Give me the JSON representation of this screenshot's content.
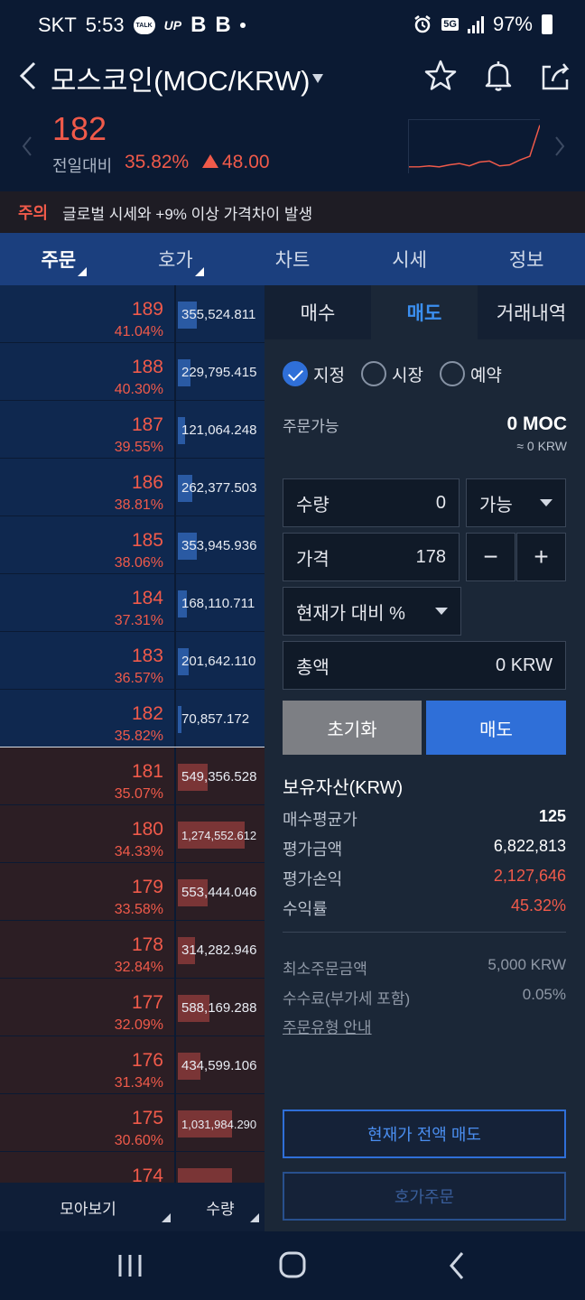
{
  "status_bar": {
    "carrier": "SKT",
    "time": "5:53",
    "talk_badge": "TALK",
    "up_badge": "UP",
    "b1": "B",
    "b2": "B",
    "net": "5G",
    "battery": "97%"
  },
  "header": {
    "title": "모스코인(MOC/KRW)"
  },
  "ticker": {
    "price": "182",
    "change_label": "전일대비",
    "change_pct": "35.82%",
    "change_amt": "48.00",
    "sparkline": [
      0.08,
      0.08,
      0.1,
      0.08,
      0.12,
      0.15,
      0.1,
      0.18,
      0.2,
      0.1,
      0.12,
      0.22,
      0.3,
      0.95
    ]
  },
  "warning": {
    "label": "주의",
    "text": "글로벌 시세와 +9% 이상 가격차이 발생"
  },
  "tabs": [
    "주문",
    "호가",
    "차트",
    "시세",
    "정보"
  ],
  "orderbook": {
    "rows": [
      {
        "side": "ask",
        "price": "189",
        "pct": "41.04%",
        "volume": "355,524.811",
        "level": 0.27
      },
      {
        "side": "ask",
        "price": "188",
        "pct": "40.30%",
        "volume": "229,795.415",
        "level": 0.18
      },
      {
        "side": "ask",
        "price": "187",
        "pct": "39.55%",
        "volume": "121,064.248",
        "level": 0.1
      },
      {
        "side": "ask",
        "price": "186",
        "pct": "38.81%",
        "volume": "262,377.503",
        "level": 0.21
      },
      {
        "side": "ask",
        "price": "185",
        "pct": "38.06%",
        "volume": "353,945.936",
        "level": 0.27
      },
      {
        "side": "ask",
        "price": "184",
        "pct": "37.31%",
        "volume": "168,110.711",
        "level": 0.13
      },
      {
        "side": "ask",
        "price": "183",
        "pct": "36.57%",
        "volume": "201,642.110",
        "level": 0.16
      },
      {
        "side": "ask",
        "price": "182",
        "pct": "35.82%",
        "volume": "70,857.172",
        "level": 0.05,
        "current": true
      },
      {
        "side": "bid",
        "price": "181",
        "pct": "35.07%",
        "volume": "549,356.528",
        "level": 0.43
      },
      {
        "side": "bid",
        "price": "180",
        "pct": "34.33%",
        "volume": "1,274,552.612",
        "level": 0.98
      },
      {
        "side": "bid",
        "price": "179",
        "pct": "33.58%",
        "volume": "553,444.046",
        "level": 0.43
      },
      {
        "side": "bid",
        "price": "178",
        "pct": "32.84%",
        "volume": "314,282.946",
        "level": 0.25
      },
      {
        "side": "bid",
        "price": "177",
        "pct": "32.09%",
        "volume": "588,169.288",
        "level": 0.46
      },
      {
        "side": "bid",
        "price": "176",
        "pct": "31.34%",
        "volume": "434,599.106",
        "level": 0.33
      },
      {
        "side": "bid",
        "price": "175",
        "pct": "30.60%",
        "volume": "1,031,984.290",
        "level": 0.79
      },
      {
        "side": "bid",
        "price": "174",
        "pct": "",
        "volume": "",
        "level": 0.79
      }
    ],
    "footer_view": "모아보기",
    "footer_qty": "수량"
  },
  "panel": {
    "tabs": [
      "매수",
      "매도",
      "거래내역"
    ],
    "radios": [
      "지정",
      "시장",
      "예약"
    ],
    "available_label": "주문가능",
    "available_value": "0 MOC",
    "available_sub": "≈ 0 KRW",
    "qty_label": "수량",
    "qty_value": "0",
    "qty_mode": "가능",
    "price_label": "가격",
    "price_value": "178",
    "minus": "−",
    "plus": "+",
    "pct_select": "현재가 대비 %",
    "total_label": "총액",
    "total_value": "0 KRW",
    "reset": "초기화",
    "sell": "매도",
    "assets_title": "보유자산(KRW)",
    "avg_label": "매수평균가",
    "avg_value": "125",
    "eval_label": "평가금액",
    "eval_value": "6,822,813",
    "pnl_label": "평가손익",
    "pnl_value": "2,127,646",
    "yield_label": "수익률",
    "yield_value": "45.32%",
    "min_label": "최소주문금액",
    "min_value": "5,000 KRW",
    "fee_label": "수수료(부가세 포함)",
    "fee_value": "0.05%",
    "guide": "주문유형 안내",
    "sell_all": "현재가 전액 매도",
    "ob_order": "호가주문"
  },
  "colors": {
    "up": "#f05a4a",
    "accent": "#2f6fd8",
    "ask_bg": "#0f284f",
    "bid_bg": "#2c1e24"
  }
}
